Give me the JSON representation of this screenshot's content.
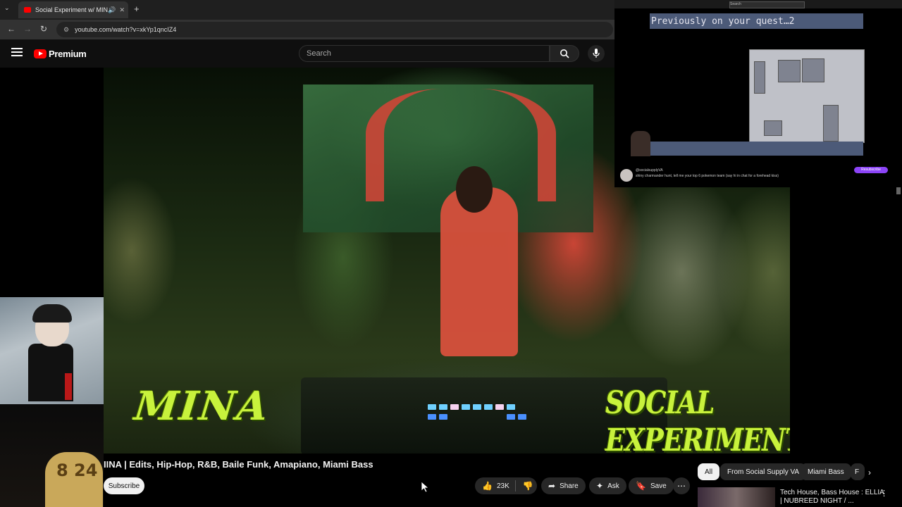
{
  "browser": {
    "tab_title": "Social Experiment w/ MINA",
    "url": "youtube.com/watch?v=xkYp1qncIZ4",
    "menu_glyph": "⌄",
    "newtab_glyph": "+",
    "back_glyph": "←",
    "forward_glyph": "→",
    "reload_glyph": "↻",
    "close_glyph": "✕",
    "audio_glyph": "🔊"
  },
  "youtube": {
    "logo_text": "Premium",
    "search_placeholder": "Search",
    "accent_color": "#ff0000"
  },
  "video": {
    "overlay_left_text": "MINA",
    "overlay_right_text": "SOCIAL EXPERIMENT"
  },
  "meta": {
    "title": "IINA | Edits, Hip-Hop, R&B, Baile Funk, Amapiano, Miami Bass",
    "subscribe_label": "Subscribe",
    "like_count": "23K",
    "share_label": "Share",
    "ask_label": "Ask",
    "save_label": "Save",
    "more_glyph": "⋯"
  },
  "chips": [
    {
      "label": "All"
    },
    {
      "label": "From Social Supply VA"
    },
    {
      "label": "Miami Bass"
    },
    {
      "label": "F"
    }
  ],
  "chip_next_glyph": "›",
  "recommendation": {
    "title": "Tech House, Bass House : ELLIA | NUBREED NIGHT / ..."
  },
  "stream_overlay": {
    "quest_text": "Previously on your quest…2",
    "search_text": "Search",
    "purple_button": "Resubscribe",
    "chat_user": "@socialsupplyVA",
    "chat_message": "shiny charmander hunt, tell me your top 6 pokemon team (say hi in chat for a forehead kiss)"
  },
  "webcam": {
    "shirt_number": "8 24"
  }
}
